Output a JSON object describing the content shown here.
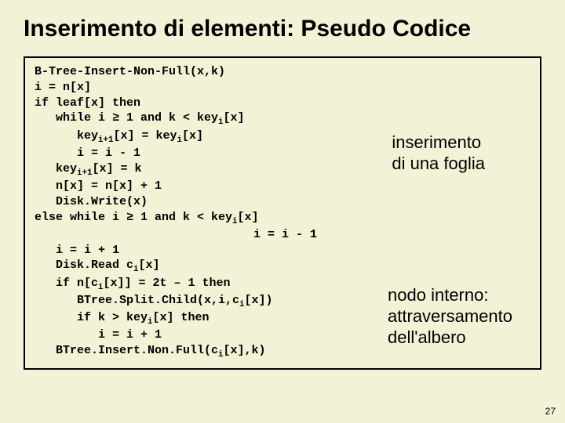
{
  "title": "Inserimento di elementi: Pseudo Codice",
  "code": {
    "l01": "B-Tree-Insert-Non-Full(x,k)",
    "l02": "i = n[x]",
    "l03": "if leaf[x] then",
    "l04_a": "   while i ≥ 1 and k < key",
    "l04_sub": "i",
    "l04_b": "[x]",
    "l05_a": "      key",
    "l05_sub1": "i+1",
    "l05_b": "[x] = key",
    "l05_sub2": "i",
    "l05_c": "[x]",
    "l06": "      i = i - 1",
    "l07_a": "   key",
    "l07_sub": "i+1",
    "l07_b": "[x] = k",
    "l08": "   n[x] = n[x] + 1",
    "l09": "   Disk.Write(x)",
    "l10_a": "else while i ≥ 1 and k < key",
    "l10_sub": "i",
    "l10_b": "[x]",
    "l11": "                               i = i - 1",
    "l12": "   i = i + 1",
    "l13_a": "   Disk.Read c",
    "l13_sub": "i",
    "l13_b": "[x]",
    "l14_a": "   if n[c",
    "l14_sub": "i",
    "l14_b": "[x]] = 2t – 1 then",
    "l15_a": "      BTree.Split.Child(x,i,c",
    "l15_sub": "i",
    "l15_b": "[x])",
    "l16_a": "      if k > key",
    "l16_sub": "i",
    "l16_b": "[x] then",
    "l17": "         i = i + 1",
    "l18_a": "   BTree.Insert.Non.Full(c",
    "l18_sub": "i",
    "l18_b": "[x],k)"
  },
  "annot1_l1": "inserimento",
  "annot1_l2": "di una foglia",
  "annot2_l1": "nodo interno:",
  "annot2_l2": "attraversamento",
  "annot2_l3": "dell'albero",
  "pagenum": "27"
}
